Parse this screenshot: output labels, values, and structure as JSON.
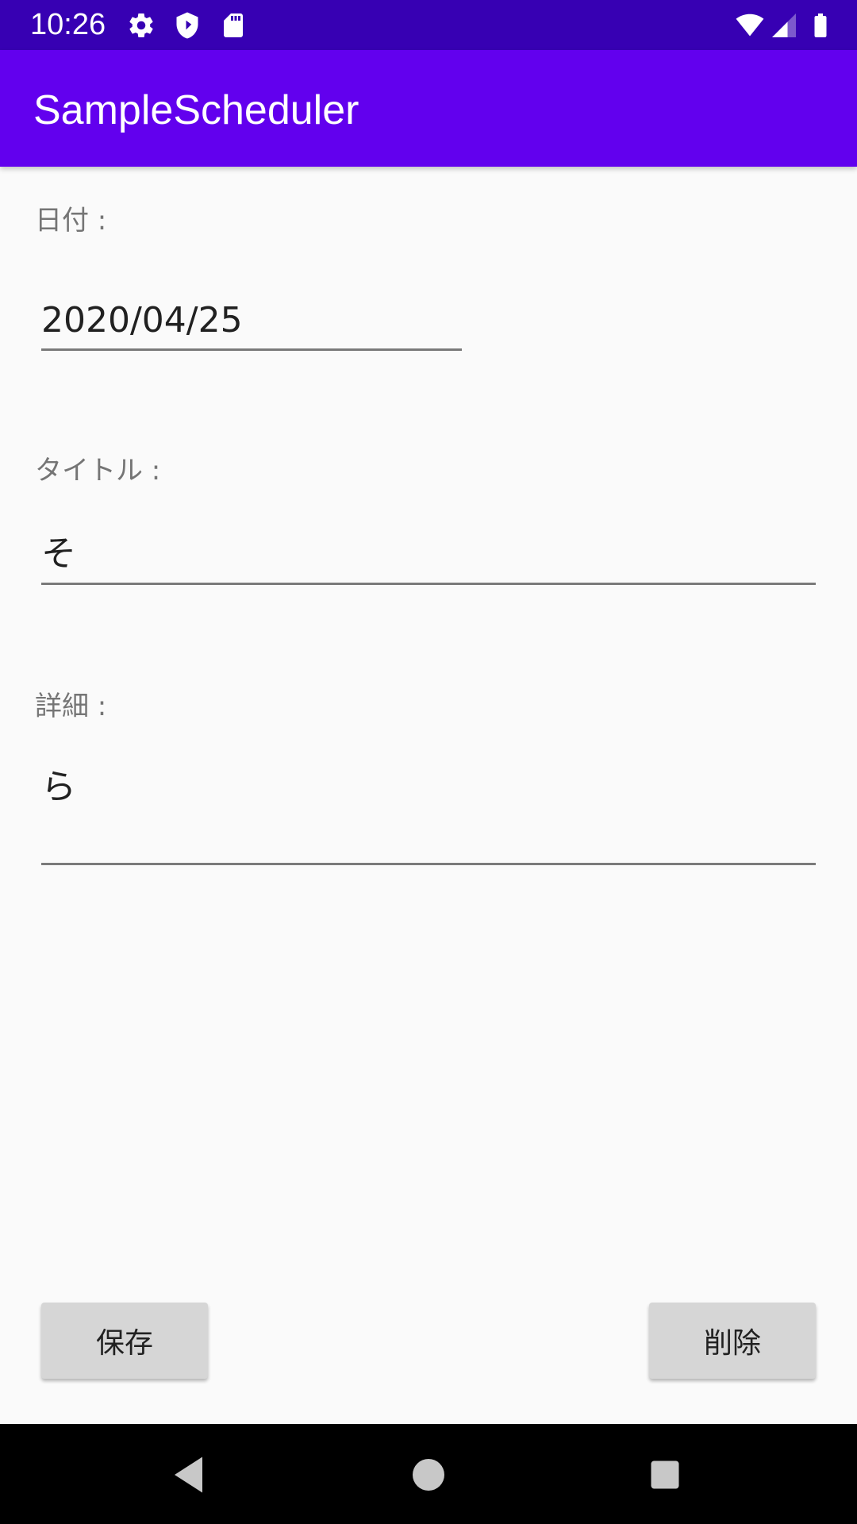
{
  "status_bar": {
    "time": "10:26",
    "left_icons": [
      "settings-icon",
      "shield-icon",
      "sd-card-icon"
    ],
    "right_icons": [
      "wifi-icon",
      "cell-signal-icon",
      "battery-icon"
    ],
    "background_color": "#3700b3"
  },
  "app_bar": {
    "title": "SampleScheduler",
    "background_color": "#6200ee"
  },
  "form": {
    "date_label": "日付 :",
    "date_value": "2020/04/25",
    "title_label": "タイトル :",
    "title_value": "そ",
    "detail_label": "詳細 :",
    "detail_value": "ら"
  },
  "buttons": {
    "save_label": "保存",
    "delete_label": "削除"
  },
  "nav_bar": {
    "icons": [
      "back-icon",
      "home-icon",
      "recents-icon"
    ]
  }
}
